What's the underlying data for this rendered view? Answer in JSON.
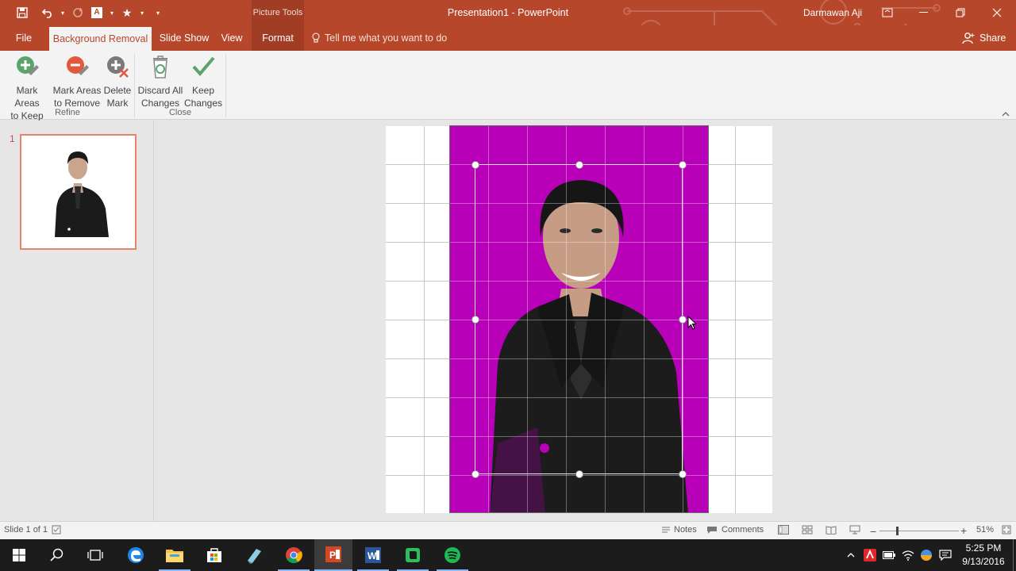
{
  "titlebar": {
    "title": "Presentation1 - PowerPoint",
    "contextual_group": "Picture Tools",
    "user": "Darmawan Aji",
    "brand_color": "#b7472a"
  },
  "tabs": [
    {
      "label": "File"
    },
    {
      "label": "Background Removal"
    },
    {
      "label": "Slide Show"
    },
    {
      "label": "View"
    },
    {
      "label": "Format"
    }
  ],
  "tell_me": "Tell me what you want to do",
  "share": "Share",
  "ribbon": {
    "groups": [
      {
        "label": "Refine",
        "buttons": [
          {
            "line1": "Mark Areas",
            "line2": "to Keep",
            "icon": "plus-pencil-icon"
          },
          {
            "line1": "Mark Areas",
            "line2": "to Remove",
            "icon": "minus-pencil-icon"
          },
          {
            "line1": "Delete",
            "line2": "Mark",
            "icon": "delete-mark-icon"
          }
        ]
      },
      {
        "label": "Close",
        "buttons": [
          {
            "line1": "Discard All",
            "line2": "Changes",
            "icon": "recycle-bin-icon"
          },
          {
            "line1": "Keep",
            "line2": "Changes",
            "icon": "checkmark-icon"
          }
        ]
      }
    ]
  },
  "thumbnails": [
    {
      "number": "1"
    }
  ],
  "statusbar": {
    "slide_info": "Slide 1 of 1",
    "notes": "Notes",
    "comments": "Comments",
    "zoom": "51%"
  },
  "clock": {
    "time": "5:25 PM",
    "date": "9/13/2016"
  }
}
